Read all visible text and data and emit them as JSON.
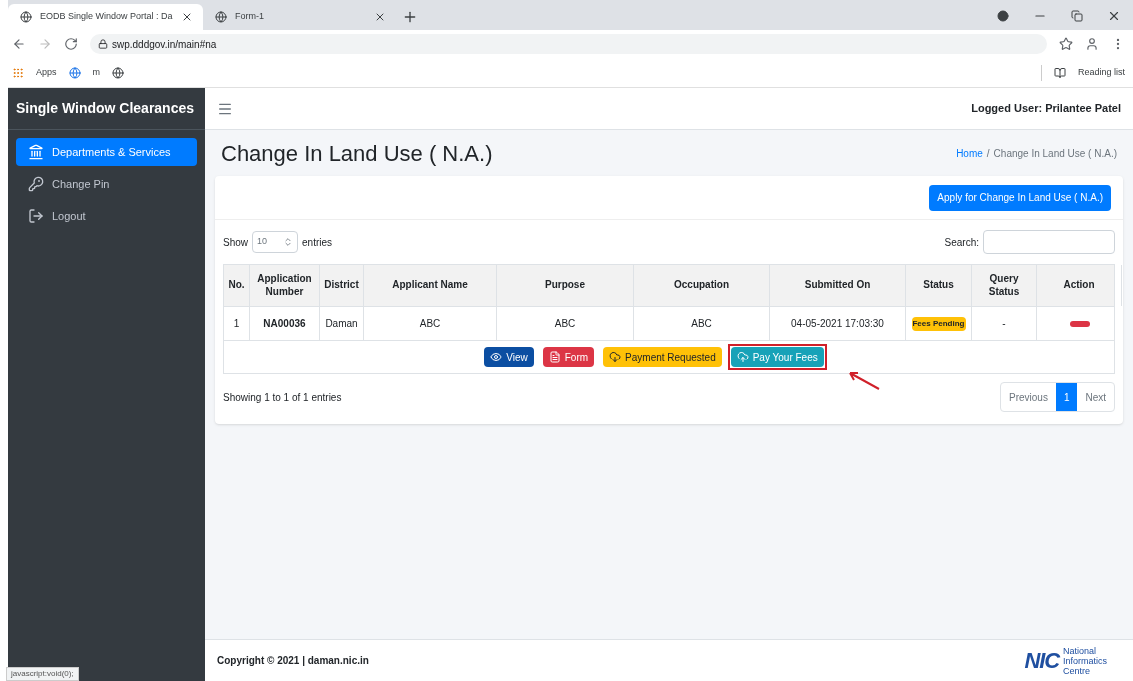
{
  "browser": {
    "tabs": [
      {
        "title": "EODB Single Window Portal : Da",
        "selected": true
      },
      {
        "title": "Form-1",
        "selected": false
      }
    ],
    "url": "swp.dddgov.in/main#na",
    "bookmarks": [
      "Apps",
      "m"
    ],
    "reading_list": "Reading list",
    "status_url": "javascript:void(0);"
  },
  "sidebar": {
    "title": "Single Window Clearances",
    "items": [
      {
        "label": "Departments & Services",
        "selected": true
      },
      {
        "label": "Change Pin",
        "selected": false
      },
      {
        "label": "Logout",
        "selected": false
      }
    ]
  },
  "header": {
    "logged_user_label": "Logged User:",
    "logged_user": "Prilantee Patel"
  },
  "page": {
    "title": "Change In Land Use ( N.A.)",
    "breadcrumb_separator": "/",
    "breadcrumb": [
      {
        "label": "Home",
        "link": true
      },
      {
        "label": "Change In Land Use ( N.A.)",
        "link": false
      }
    ]
  },
  "card": {
    "apply_button": "Apply for Change In Land Use ( N.A.)",
    "show_label": "Show",
    "page_size": "10",
    "entries_label": "entries",
    "search_label": "Search:",
    "table": {
      "columns": [
        "No.",
        "Application Number",
        "District",
        "Applicant Name",
        "Purpose",
        "Occupation",
        "Submitted On",
        "Status",
        "Query Status",
        "Action"
      ],
      "rows": [
        {
          "no": "1",
          "application_number": "NA00036",
          "district": "Daman",
          "applicant_name": "ABC",
          "purpose": "ABC",
          "occupation": "ABC",
          "submitted_on": "04-05-2021 17:03:30",
          "status": "Fees Pending",
          "query_status": "-",
          "actions": [
            {
              "label": "View",
              "kind": "view",
              "highlighted": false
            },
            {
              "label": "Form",
              "kind": "form",
              "highlighted": false
            },
            {
              "label": "Payment Requested",
              "kind": "payment",
              "highlighted": false
            },
            {
              "label": "Pay Your Fees",
              "kind": "pay",
              "highlighted": true
            }
          ]
        }
      ]
    },
    "info": "Showing 1 to 1 of 1 entries",
    "pagination": [
      {
        "label": "Previous",
        "selected": false
      },
      {
        "label": "1",
        "selected": true
      },
      {
        "label": "Next",
        "selected": false
      }
    ]
  },
  "footer": {
    "copyright": "Copyright © 2021 | daman.nic.in",
    "logo": "NIC",
    "logo_caption": "National Informatics Centre"
  }
}
